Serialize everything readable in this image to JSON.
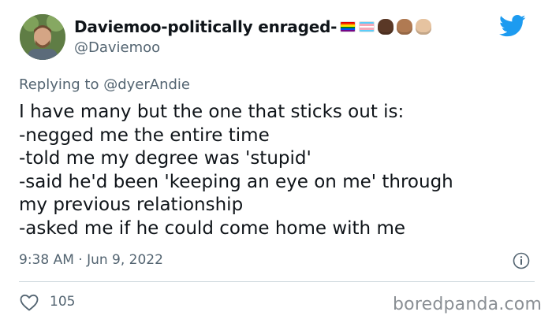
{
  "author": {
    "display_name": "Daviemoo-politically enraged-",
    "handle": "@Daviemoo",
    "avatar_icon": "user-avatar",
    "name_emoji": [
      {
        "icon": "rainbow-flag-icon",
        "colors": [
          "#e40303",
          "#ff8c00",
          "#ffed00",
          "#008026",
          "#004dff",
          "#750787"
        ]
      },
      {
        "icon": "transgender-flag-icon",
        "colors": [
          "#5bcefa",
          "#f5a9b8",
          "#ffffff",
          "#f5a9b8",
          "#5bcefa"
        ]
      },
      {
        "icon": "raised-fist-dark-icon",
        "color": "#5a3826"
      },
      {
        "icon": "raised-fist-medium-icon",
        "color": "#b07a52"
      },
      {
        "icon": "raised-fist-light-icon",
        "color": "#e6c3a0"
      }
    ]
  },
  "brand": {
    "icon": "twitter-bird-icon",
    "color": "#1d9bf0"
  },
  "reply": {
    "prefix": "Replying to",
    "mention": "@dyerAndie"
  },
  "tweet": {
    "lines": [
      "I have many but the one that sticks out is:",
      "-negged me the entire time",
      "-told me my degree was 'stupid'",
      "-said he'd been 'keeping an eye on me' through",
      "my previous relationship",
      "-asked me if he could come home with me"
    ],
    "timestamp": "9:38 AM · Jun 9, 2022"
  },
  "engagement": {
    "like_icon": "heart-icon",
    "likes": "105"
  },
  "watermark": "boredpanda.com",
  "colors": {
    "text": "#0f1419",
    "muted": "#536471",
    "divider": "#cfd9de"
  }
}
